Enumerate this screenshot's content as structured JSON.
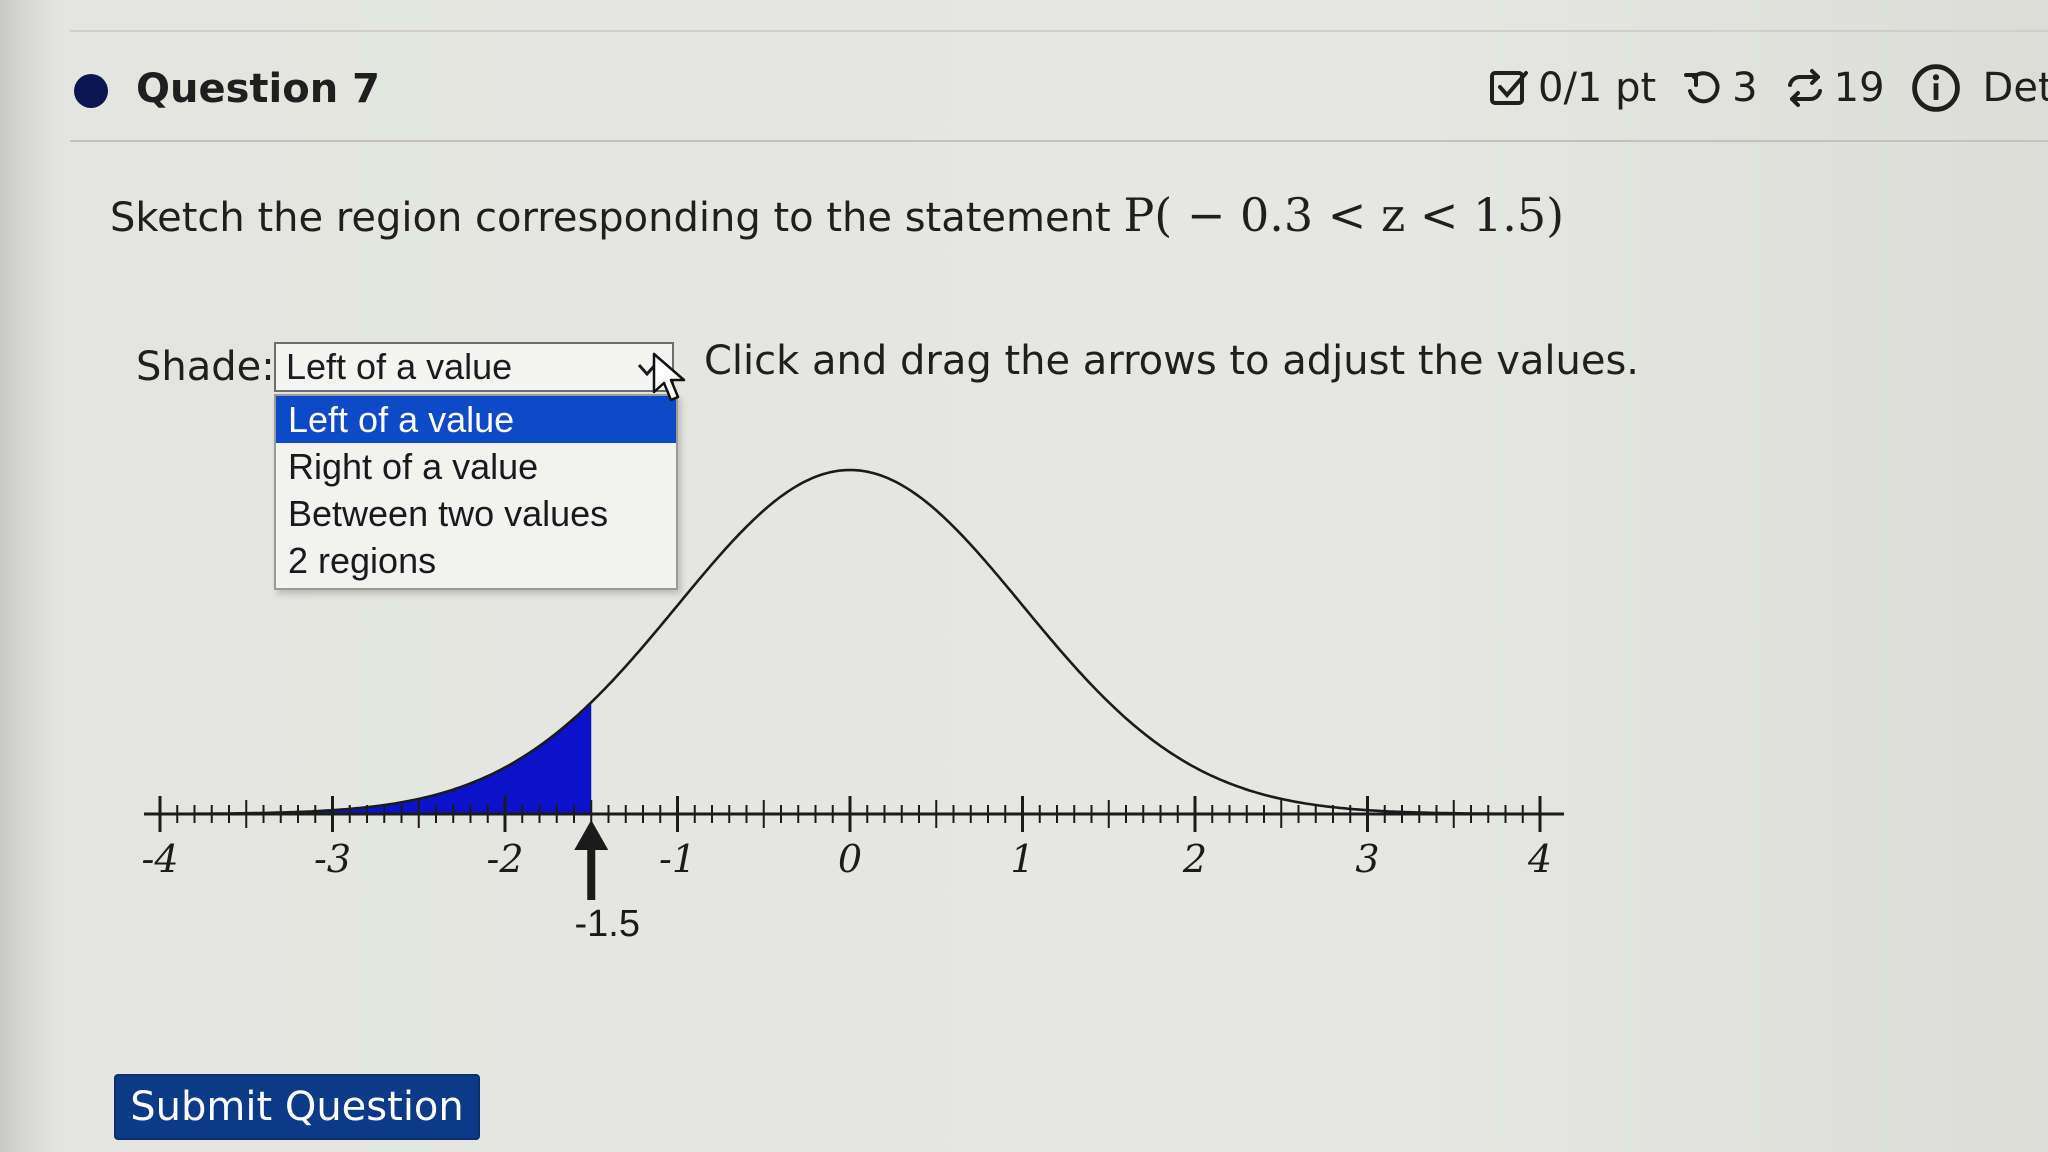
{
  "question": {
    "title": "Question 7",
    "points": "0/1 pt",
    "retries": "3",
    "attempts": "19",
    "details_label": "Det"
  },
  "prompt": {
    "text": "Sketch the region corresponding to the statement",
    "math": "P( − 0.3 < z < 1.5)"
  },
  "shade": {
    "label": "Shade:",
    "selected": "Left of a value",
    "options": [
      "Left of a value",
      "Right of a value",
      "Between two values",
      "2 regions"
    ],
    "highlighted_index": 0
  },
  "instructions": "Click and drag the arrows to adjust the values.",
  "chart_data": {
    "type": "area",
    "curve": "standard normal density",
    "xlim": [
      -4,
      4
    ],
    "tick_labels": [
      "-4",
      "-3",
      "-2",
      "-1",
      "0",
      "1",
      "2",
      "3",
      "4"
    ],
    "shaded_region": {
      "from": -4,
      "to": -1.5
    },
    "arrow_value": -1.5,
    "arrow_label": "-1.5",
    "shade_color": "#0b12c8"
  },
  "submit_label": "Submit Question",
  "colors": {
    "accent": "#0e49c8",
    "submit": "#0c3a86",
    "dot": "#0c1550"
  },
  "icons": {
    "points": "checkbox-icon",
    "retries": "retry-icon",
    "attempts": "repeat-icon",
    "details": "info-icon"
  }
}
